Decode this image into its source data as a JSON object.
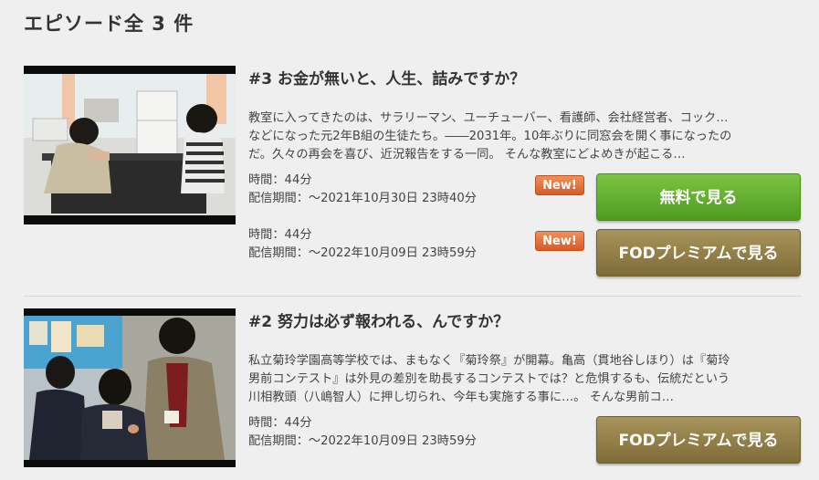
{
  "heading": "エピソード全 3 件",
  "colors": {
    "free_button": "#5aa82a",
    "premium_button": "#8e7c45",
    "new_badge": "#e06b36"
  },
  "episodes": [
    {
      "title": "#3 お金が無いと、人生、詰みですか？",
      "synopsis_lines": [
        "教室に入ってきたのは、サラリーマン、ユーチューバー、看護師、会社経営者、コック…",
        "などになった元2年B組の生徒たち。――2031年。10年ぶりに同窓会を開く事になったの",
        "だ。久々の再会を喜び、近況報告をする一同。 そんな教室にどよめきが起こる…"
      ],
      "offers": [
        {
          "duration": "時間：44分",
          "period": "配信期間：～2021年10月30日 23時40分",
          "badge": "New!",
          "button": "無料で見る",
          "button_icon": "play-free"
        },
        {
          "duration": "時間：44分",
          "period": "配信期間：～2022年10月09日 23時59分",
          "badge": "New!",
          "button": "FODプレミアムで見る",
          "button_icon": "play-premium"
        }
      ]
    },
    {
      "title": "#2 努力は必ず報われる、んですか？",
      "synopsis_lines": [
        "私立菊玲学園高等学校では、まもなく『菊玲祭』が開幕。亀高（貫地谷しほり）は『菊玲",
        "男前コンテスト』は外見の差別を助長するコンテストでは？と危惧するも、伝統だという",
        "川相教頭（八嶋智人）に押し切られ、今年も実施する事に…。 そんな男前コ…"
      ],
      "offers": [
        {
          "duration": "時間：44分",
          "period": "配信期間：～2022年10月09日 23時59分",
          "button": "FODプレミアムで見る"
        }
      ]
    }
  ]
}
